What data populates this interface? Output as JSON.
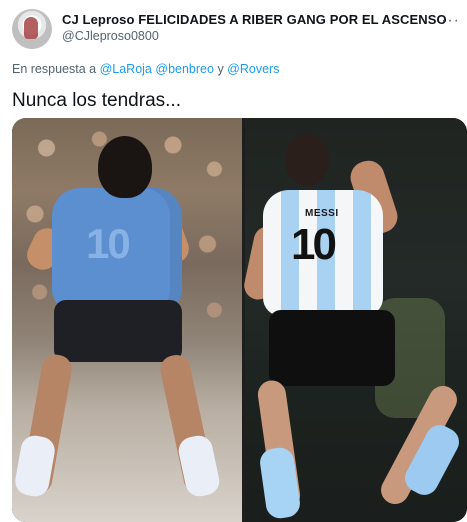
{
  "tweet": {
    "user": {
      "display_name": "CJ Leproso FELICIDADES A RIBER GANG POR EL ASCENSO",
      "handle": "@CJleproso0800"
    },
    "more_menu": "···",
    "reply_to": {
      "prefix": "En respuesta a",
      "users": [
        "@LaRoja",
        "@benbreo",
        "@Rovers"
      ],
      "conjunction": "y"
    },
    "text": "Nunca los tendras...",
    "media": {
      "left_photo": {
        "shirt_number": "10"
      },
      "right_photo": {
        "shirt_name": "MESSI",
        "shirt_number": "10"
      }
    }
  }
}
